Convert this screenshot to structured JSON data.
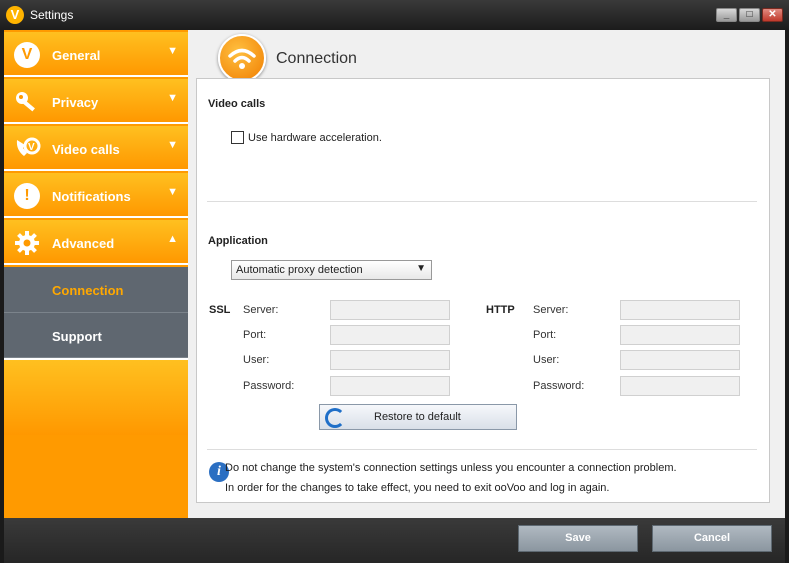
{
  "window": {
    "title": "Settings",
    "logo_glyph": "V",
    "minimize_icon": "minimize-icon",
    "maximize_icon": "maximize-icon",
    "close_icon": "close-icon"
  },
  "colors": {
    "accent": "#ff9a00",
    "active_nav": "#5f6770",
    "active_text": "#ffa800",
    "info": "#2b6fc2"
  },
  "sidebar": {
    "items": [
      {
        "label": "General",
        "icon": "v-logo-icon",
        "chevron": "▼"
      },
      {
        "label": "Privacy",
        "icon": "key-icon",
        "chevron": "▼"
      },
      {
        "label": "Video calls",
        "icon": "video-call-icon",
        "chevron": "▼"
      },
      {
        "label": "Notifications",
        "icon": "exclamation-icon",
        "chevron": "▼"
      },
      {
        "label": "Advanced",
        "icon": "gear-icon",
        "chevron": "▲"
      },
      {
        "label": "Connection"
      },
      {
        "label": "Support"
      }
    ]
  },
  "header": {
    "title": "Connection",
    "icon": "wifi-icon"
  },
  "video_calls": {
    "section_title": "Video calls",
    "hw_accel_label": "Use hardware acceleration.",
    "hw_accel_checked": false
  },
  "application": {
    "section_title": "Application",
    "proxy_select": {
      "value": "Automatic proxy detection"
    },
    "ssl": {
      "label": "SSL",
      "server_label": "Server:",
      "port_label": "Port:",
      "user_label": "User:",
      "password_label": "Password:",
      "server": "",
      "port": "",
      "user": "",
      "password": ""
    },
    "http": {
      "label": "HTTP",
      "server_label": "Server:",
      "port_label": "Port:",
      "user_label": "User:",
      "password_label": "Password:",
      "server": "",
      "port": "",
      "user": "",
      "password": ""
    },
    "restore_label": "Restore to default"
  },
  "info": {
    "line1": "Do not change the system's connection settings unless you encounter a connection problem.",
    "line2": "In order for the changes to take effect, you need to exit ooVoo and log in again."
  },
  "footer": {
    "save_label": "Save",
    "cancel_label": "Cancel"
  }
}
